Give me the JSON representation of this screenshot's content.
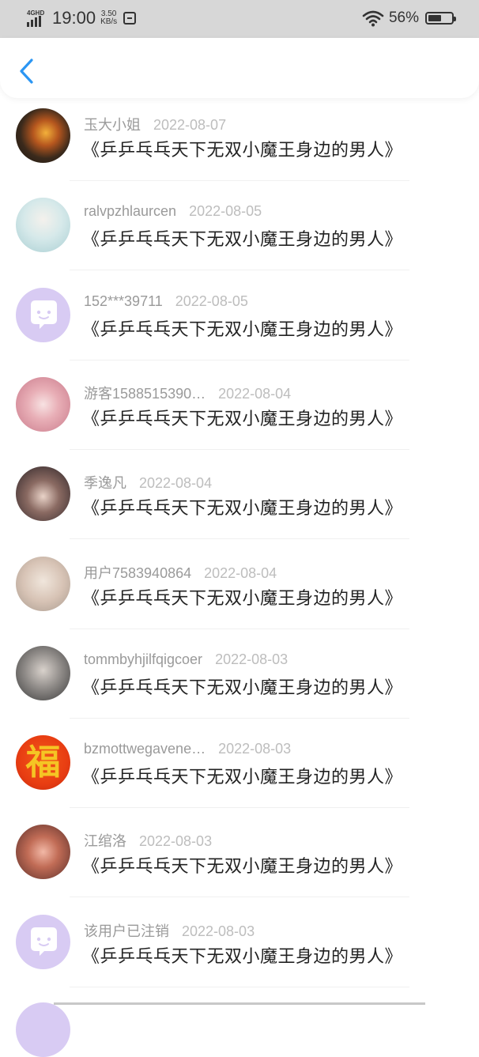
{
  "status_bar": {
    "network": "4GHD",
    "time": "19:00",
    "speed_value": "3.50",
    "speed_unit": "KB/s",
    "battery_percent": "56%",
    "battery_level": 0.56
  },
  "header": {
    "back_icon": "chevron-left-icon",
    "accent_color": "#2b96f3"
  },
  "list": {
    "items": [
      {
        "username": "玉大小姐",
        "date": "2022-08-07",
        "title": "《乒乒乓乓天下无双小魔王身边的男人》",
        "avatar": "photo"
      },
      {
        "username": "ralvpzhlaurcen",
        "date": "2022-08-05",
        "title": "《乒乒乓乓天下无双小魔王身边的男人》",
        "avatar": "photo"
      },
      {
        "username": "152***39711",
        "date": "2022-08-05",
        "title": "《乒乒乓乓天下无双小魔王身边的男人》",
        "avatar": "default-chat-icon"
      },
      {
        "username": "游客1588515390…",
        "date": "2022-08-04",
        "title": "《乒乒乓乓天下无双小魔王身边的男人》",
        "avatar": "photo"
      },
      {
        "username": "季逸凡",
        "date": "2022-08-04",
        "title": "《乒乒乓乓天下无双小魔王身边的男人》",
        "avatar": "photo"
      },
      {
        "username": "用户7583940864",
        "date": "2022-08-04",
        "title": "《乒乒乓乓天下无双小魔王身边的男人》",
        "avatar": "photo"
      },
      {
        "username": "tommbyhjilfqigcoer",
        "date": "2022-08-03",
        "title": "《乒乒乓乓天下无双小魔王身边的男人》",
        "avatar": "photo"
      },
      {
        "username": "bzmottwegavene…",
        "date": "2022-08-03",
        "title": "《乒乒乓乓天下无双小魔王身边的男人》",
        "avatar": "fu-character",
        "avatar_text": "福"
      },
      {
        "username": "江绾洛",
        "date": "2022-08-03",
        "title": "《乒乒乓乓天下无双小魔王身边的男人》",
        "avatar": "photo"
      },
      {
        "username": "该用户已注销",
        "date": "2022-08-03",
        "title": "《乒乒乓乓天下无双小魔王身边的男人》",
        "avatar": "default-chat-icon"
      }
    ]
  }
}
